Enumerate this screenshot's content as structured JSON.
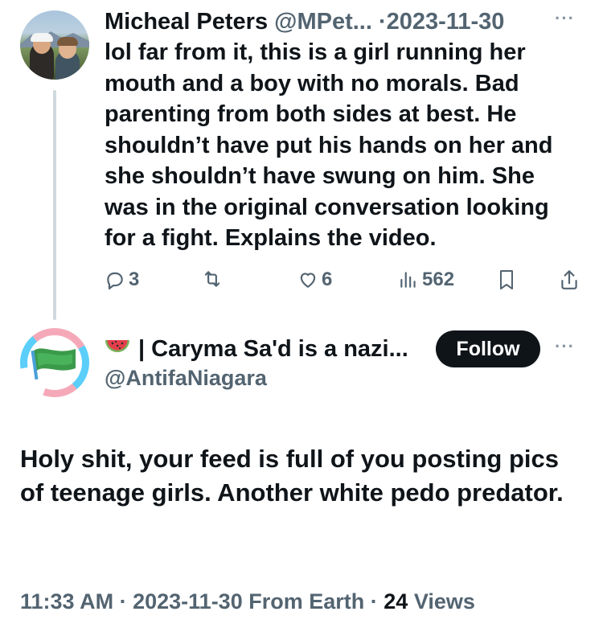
{
  "reply_post": {
    "author_name": "Micheal Peters",
    "handle": "@MPet...",
    "separator": "·",
    "date": "2023-11-30",
    "body": "lol far from it, this is a girl running her mouth and a boy with no morals. Bad parenting from both sides at best. He shouldn’t have put his hands on her and she shouldn’t have swung on him. She was in the original conversation looking for a fight. Explains the video.",
    "actions": {
      "reply_count": "3",
      "repost_count": "",
      "like_count": "6",
      "views_count": "562"
    }
  },
  "main_post": {
    "author_emoji": "watermelon-icon",
    "author_name": "| Caryma Sa'd is a nazi...",
    "handle": "@AntifaNiagara",
    "follow_label": "Follow",
    "body": "Holy shit, your feed is full of you posting pics of teenage girls.  Another white pedo predator.",
    "time": "11:33 AM",
    "sep1": "·",
    "date_source": "2023-11-30 From Earth",
    "sep2": "·",
    "views_count": "24",
    "views_label": "Views"
  },
  "colors": {
    "text": "#0f1419",
    "muted": "#536471",
    "thread_line": "#cfd9de",
    "follow_bg": "#0f1419"
  }
}
